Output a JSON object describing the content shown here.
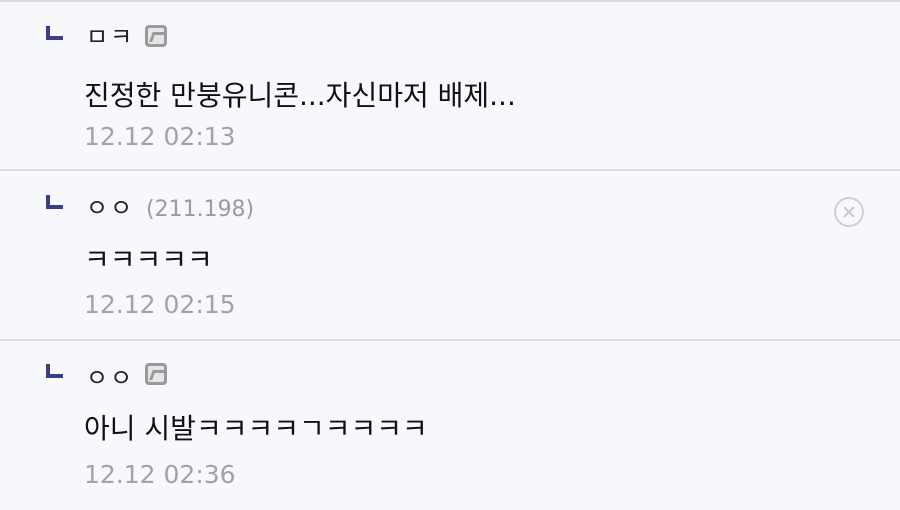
{
  "replies": [
    {
      "nickname": "ㅁㅋ",
      "has_gallog_icon": true,
      "icon": "gallog-icon",
      "text": "진정한 만붕유니콘...자신마저 배제...",
      "date": "12.12 02:13"
    },
    {
      "nickname": "ㅇㅇ",
      "ip": "(211.198)",
      "has_gallog_icon": false,
      "text": "ㅋㅋㅋㅋㅋ",
      "date": "12.12 02:15",
      "delete_icon": "close-circle-icon"
    },
    {
      "nickname": "ㅇㅇ",
      "has_gallog_icon": true,
      "icon": "gallog-icon",
      "text": "아니 시발ㅋㅋㅋㅋㄱㅋㅋㅋㅋ",
      "date": "12.12 02:36"
    }
  ],
  "colors": {
    "background": "#f7f8fc",
    "reply_arrow": "#3a3f86",
    "ip_text": "#9b9b9b",
    "date_text": "#a3a3a3",
    "divider": "#dcdde3"
  }
}
